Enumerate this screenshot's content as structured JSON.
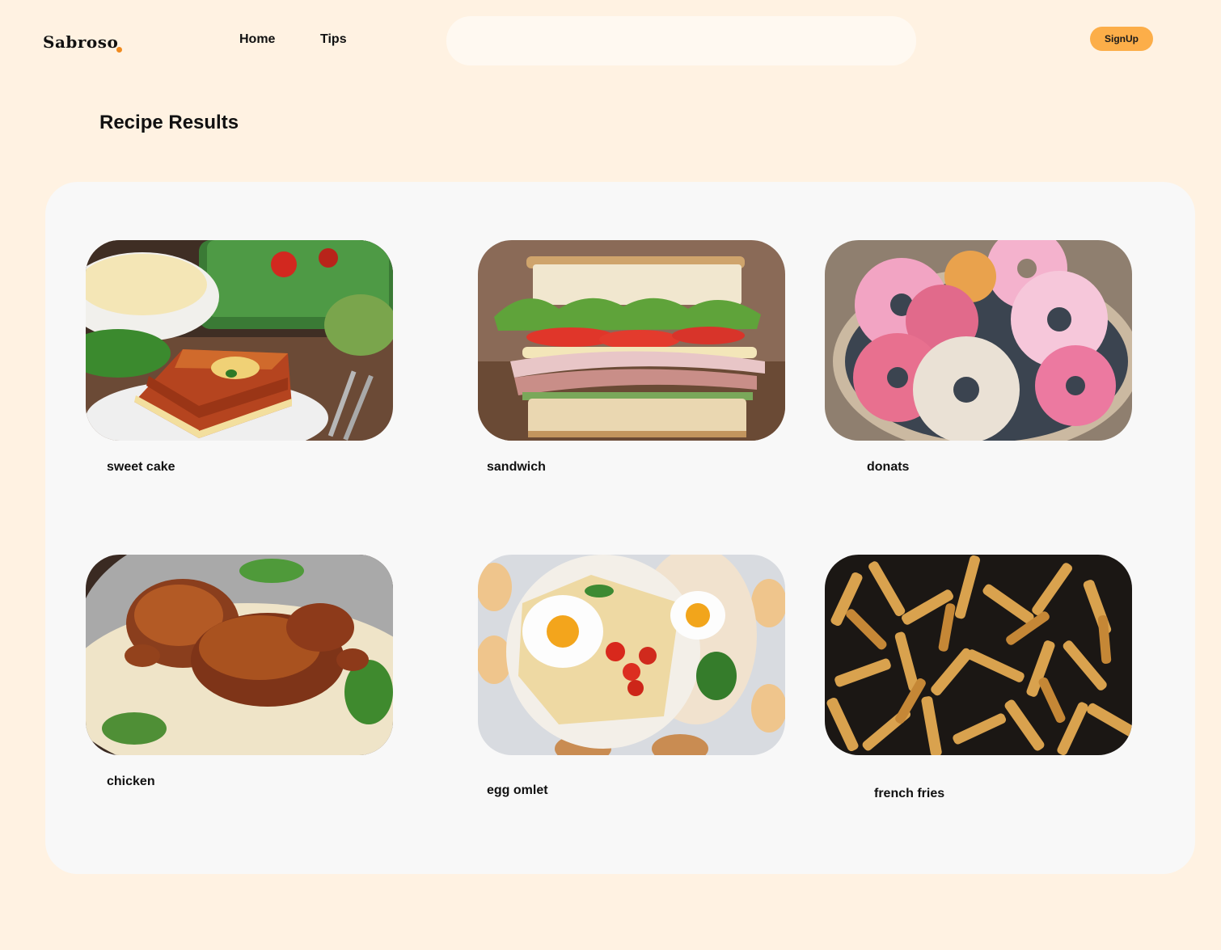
{
  "header": {
    "logo": "Sabroso",
    "nav": [
      {
        "label": "Home"
      },
      {
        "label": "Tips"
      }
    ],
    "search": {
      "value": "",
      "placeholder": ""
    },
    "signup_label": "SignUp"
  },
  "main": {
    "title": "Recipe Results",
    "recipes": [
      {
        "name": "sweet cake",
        "image": "lasagna"
      },
      {
        "name": "sandwich",
        "image": "club-sandwich"
      },
      {
        "name": "donats",
        "image": "donuts"
      },
      {
        "name": "chicken",
        "image": "roast-chicken-on-rice"
      },
      {
        "name": "egg omlet",
        "image": "egg-omelet-plate"
      },
      {
        "name": "french fries",
        "image": "french-fries"
      }
    ]
  },
  "colors": {
    "background": "#fff2e2",
    "panel": "#f8f8f8",
    "accent": "#fcae49",
    "logo_dot": "#f08a1e"
  }
}
